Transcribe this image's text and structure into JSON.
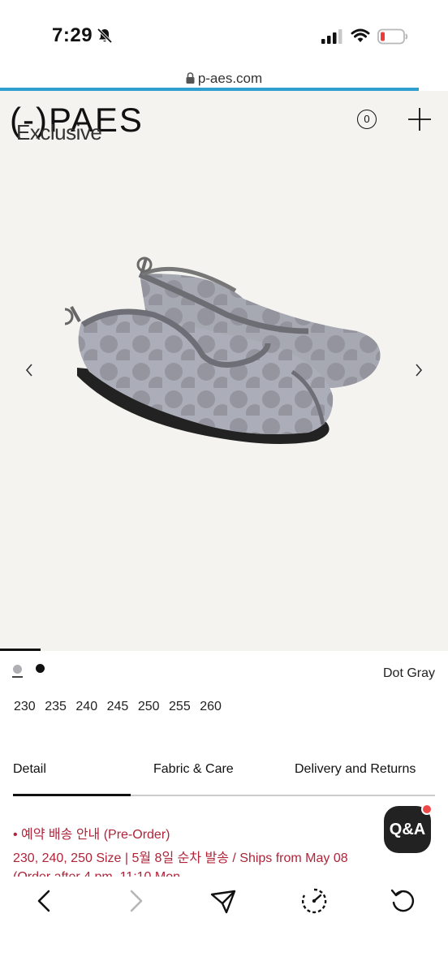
{
  "status_bar": {
    "time": "7:29"
  },
  "browser": {
    "url": "p-aes.com"
  },
  "header": {
    "brand": "(-)PAES",
    "label": "Exclusive",
    "cart_count": "0"
  },
  "product": {
    "color_name": "Dot Gray",
    "swatches": [
      "gray",
      "black"
    ],
    "sizes": [
      "230",
      "235",
      "240",
      "245",
      "250",
      "255",
      "260"
    ]
  },
  "tabs": [
    "Detail",
    "Fabric & Care",
    "Delivery and Returns"
  ],
  "notice": {
    "line1": "•  예약 배송 안내 (Pre-Order)",
    "line2": "230, 240, 250 Size | 5월 8일 순차 발송 / Ships from May 08",
    "line3": "(Order after 4 pm, 11:10 Mon..."
  },
  "qa_button": {
    "label": "Q&A"
  },
  "colors": {
    "accent": "#b0243a",
    "load_bar": "#2f9fd0",
    "qa_dot": "#ee4848"
  },
  "icons": [
    "bell-slash-icon",
    "signal-icon",
    "wifi-icon",
    "battery-icon",
    "lock-icon",
    "plus-icon",
    "chevron-left-icon",
    "chevron-right-icon",
    "share-icon",
    "speed-icon",
    "reload-icon"
  ]
}
